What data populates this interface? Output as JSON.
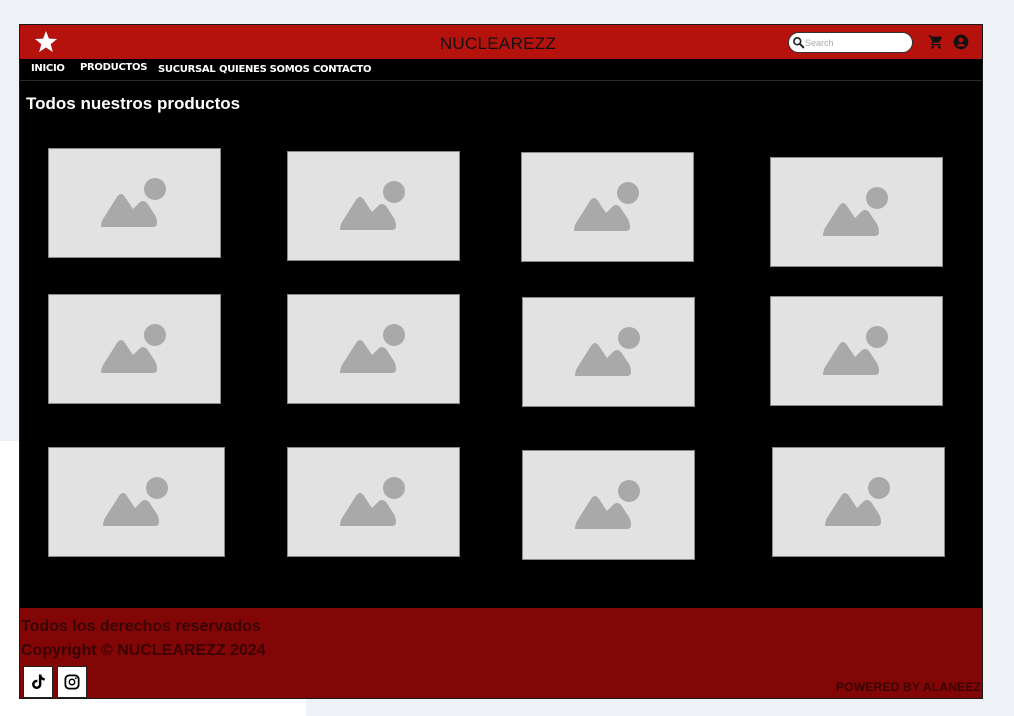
{
  "header": {
    "brand": "NUCLEAREZZ",
    "search_placeholder": "Search",
    "colors": {
      "topbar": "#b5120d",
      "footer": "#820606"
    }
  },
  "nav": {
    "items": [
      {
        "label": "INICIO"
      },
      {
        "label": "PRODUCTOS"
      },
      {
        "label": "SUCURSAL"
      },
      {
        "label": "QUIENES SOMOS"
      },
      {
        "label": "CONTACTO"
      }
    ]
  },
  "main": {
    "title": "Todos nuestros productos",
    "product_count": 12,
    "placeholder_icon": "image-placeholder-icon"
  },
  "footer": {
    "rights": "Todos los derechos reservados",
    "copyright": "Copyright © NUCLEAREZZ 2024",
    "powered": "POWERED BY ALANEEZ",
    "social": [
      {
        "icon": "tiktok-icon"
      },
      {
        "icon": "instagram-icon"
      }
    ]
  }
}
